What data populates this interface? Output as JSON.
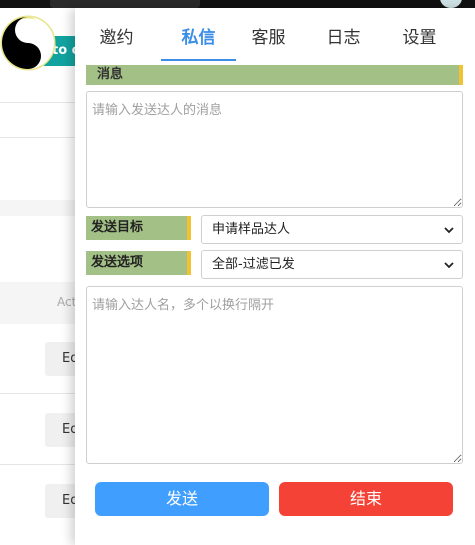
{
  "background": {
    "teal_button_label": "to c",
    "column_header": "Act",
    "row_button_label": "Ed"
  },
  "tabs": [
    {
      "label": "邀约",
      "active": false
    },
    {
      "label": "私信",
      "active": true
    },
    {
      "label": "客服",
      "active": false
    },
    {
      "label": "日志",
      "active": false
    },
    {
      "label": "设置",
      "active": false
    }
  ],
  "message_section": {
    "title": "消息",
    "placeholder": "请输入发送达人的消息",
    "value": ""
  },
  "send_target": {
    "label": "发送目标",
    "selected": "申请样品达人"
  },
  "send_option": {
    "label": "发送选项",
    "selected": "全部-过滤已发"
  },
  "names_input": {
    "placeholder": "请输入达人名，多个以换行隔开",
    "value": ""
  },
  "buttons": {
    "send": "发送",
    "end": "结束"
  },
  "colors": {
    "accent": "#3a8ee6",
    "section_green": "#a3c186",
    "section_edge": "#f1c232",
    "send_button": "#409eff",
    "end_button": "#f44336",
    "teal": "#12a3a0"
  }
}
